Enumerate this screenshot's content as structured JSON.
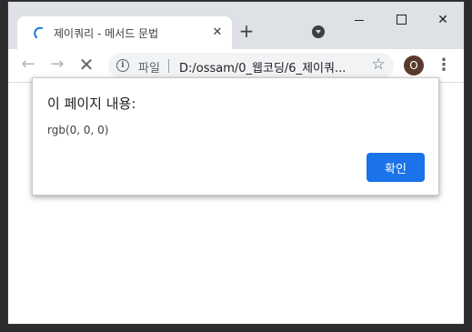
{
  "browser": {
    "tab": {
      "title": "제이쿼리 - 메서드 문법",
      "close_glyph": "✕",
      "favicon_icon": "loading-spinner-icon"
    },
    "new_tab_glyph": "+",
    "window_controls": {
      "close_glyph": "✕"
    },
    "toolbar": {
      "back_glyph": "←",
      "forward_glyph": "→",
      "stop_glyph": "✕",
      "omnibox": {
        "info_glyph": "i",
        "scheme_label": "파일",
        "url": "D:/ossam/0_웹코딩/6_제이쿼..."
      },
      "star_glyph": "☆",
      "profile_initial": "O",
      "menu_glyph": "⋮"
    }
  },
  "dialog": {
    "title": "이 페이지 내용:",
    "message": "rgb(0, 0, 0)",
    "ok_label": "확인"
  },
  "colors": {
    "accent": "#1a73e8",
    "titlebar": "#dee1e6",
    "profile": "#5b3a2e"
  }
}
